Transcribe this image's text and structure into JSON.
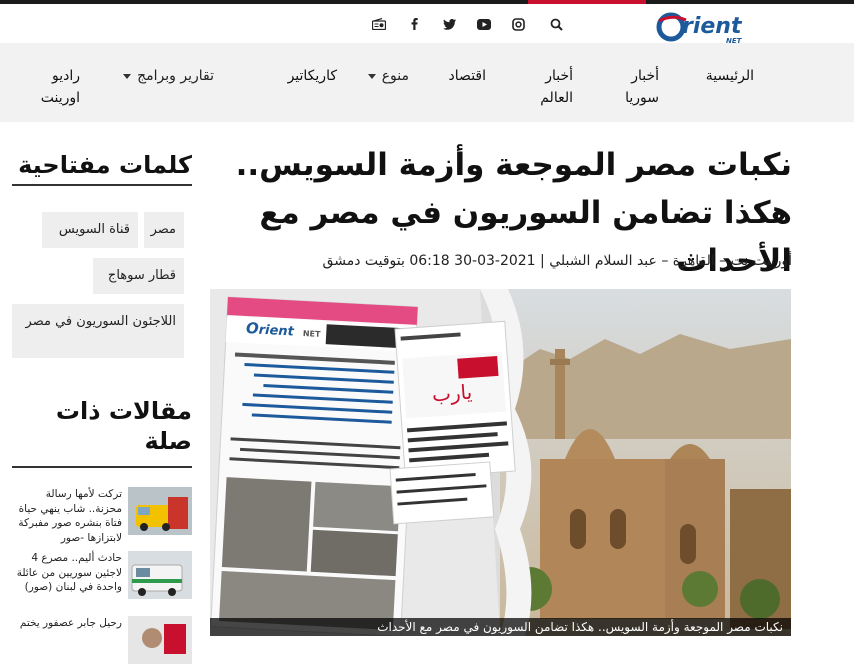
{
  "header": {
    "logo_text": "rient",
    "logo_sub": "NET",
    "logo_o": "O",
    "icons": [
      "search-icon",
      "instagram-icon",
      "youtube-icon",
      "twitter-icon",
      "facebook-icon",
      "radio-icon"
    ]
  },
  "nav": {
    "items": [
      {
        "label": "الرئيسية"
      },
      {
        "label": "أخبار سوريا"
      },
      {
        "label": "أخبار العالم"
      },
      {
        "label": "اقتصاد"
      },
      {
        "label": "منوع"
      },
      {
        "label": "كاريكاتير"
      },
      {
        "label": "تقارير وبرامج"
      },
      {
        "label": "راديو اورينت"
      }
    ]
  },
  "article": {
    "title": "نكبات مصر الموجعة وأزمة السويس.. هكذا تضامن السوريون في مصر مع الأحداث",
    "byline": "أورينت نت – القاهرة – عبد السلام الشبلي | 2021-03-30 06:18 بتوقيت دمشق",
    "caption": "نكبات مصر الموجعة وأزمة السويس.. هكذا تضامن السوريون في مصر مع الأحداث",
    "hero_logo": "rient",
    "hero_logo_o": "O",
    "hero_logo_sub": "NET",
    "hero_handwriting": "يارب"
  },
  "sidebar": {
    "keywords_heading": "كلمات مفتاحية",
    "tags": [
      {
        "label": "مصر"
      },
      {
        "label": "قناة السويس"
      },
      {
        "label": "قطار سوهاج"
      },
      {
        "label": "اللاجئون السوريون في مصر"
      }
    ],
    "related_heading": "مقالات ذات صلة",
    "related": [
      {
        "text": "تركت لأمها رسالة محزنة.. شاب ينهي حياة فتاة بنشره صور مفبركة لابتزازها -صور"
      },
      {
        "text": "حادث أليم.. مصرع 4 لاجئين سوريين من عائلة واحدة في لبنان (صور)"
      },
      {
        "text": "رحيل جابر عصفور يختم"
      }
    ]
  },
  "colors": {
    "accent": "#c8102e",
    "brand_blue": "#1d5a9c",
    "nav_bg": "#f2f2f2",
    "tag_bg": "#eeeeee"
  }
}
